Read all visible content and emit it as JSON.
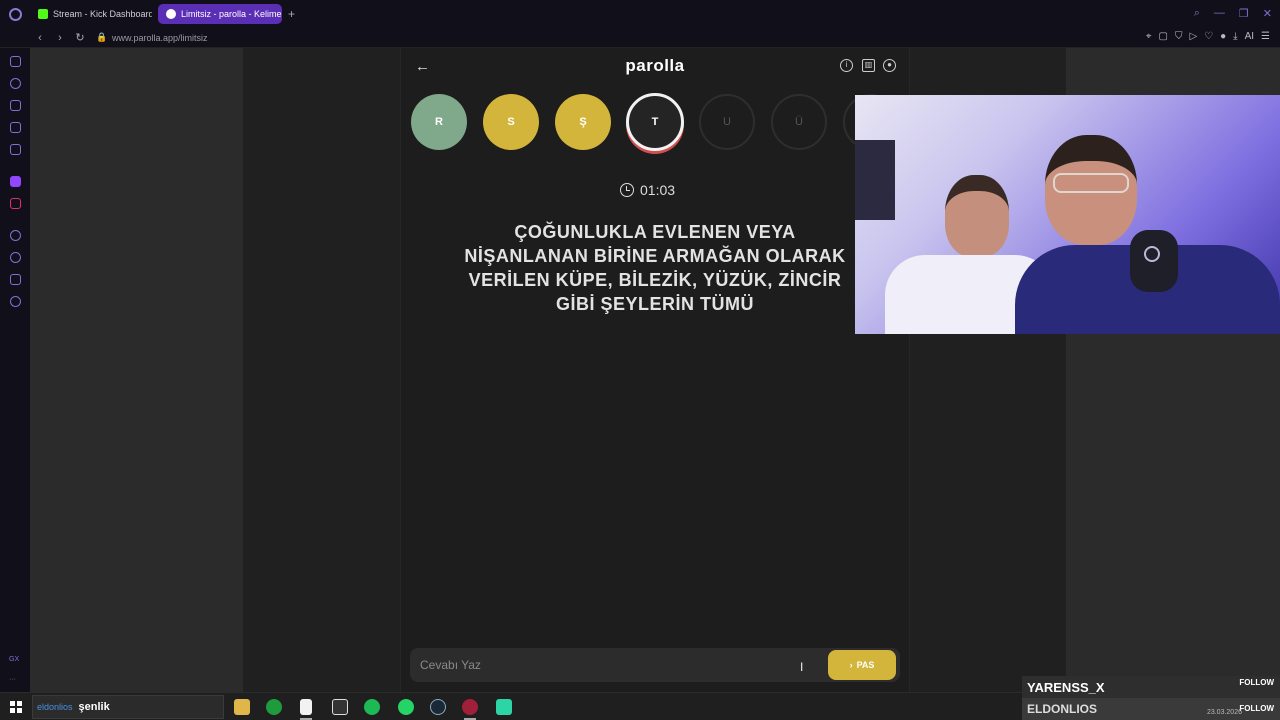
{
  "browser": {
    "tabs": [
      {
        "label": "Stream - Kick Dashboard",
        "active": false
      },
      {
        "label": "Limitsiz - parolla - Kelime",
        "active": true
      }
    ],
    "new_tab": "+",
    "url": "www.parolla.app/limitsiz",
    "ai_label": "AI"
  },
  "app": {
    "brand": "parolla",
    "letters": [
      {
        "char": "R",
        "state": "correct"
      },
      {
        "char": "S",
        "state": "passed"
      },
      {
        "char": "Ş",
        "state": "passed"
      },
      {
        "char": "T",
        "state": "active"
      },
      {
        "char": "U",
        "state": "pending"
      },
      {
        "char": "Ü",
        "state": "pending"
      }
    ],
    "timer": "01:03",
    "question": "ÇOĞUNLUKLA EVLENEN VEYA NİŞANLANAN BİRİNE ARMAĞAN OLARAK VERİLEN KÜPE, BİLEZİK, YÜZÜK, ZİNCİR GİBİ ŞEYLERİN TÜMÜ",
    "answer_placeholder": "Cevabı Yaz",
    "pass_label": "PAS",
    "colors": {
      "correct": "#7fa98a",
      "passed": "#d4b53c",
      "active_ring": "#f2f2f2"
    }
  },
  "sidebar": {
    "bottom_label": "GX",
    "more": "···"
  },
  "overlay": {
    "follower_1": "YARENSS_X",
    "follow_label_1": "FOLLOW",
    "follower_2": "ELDONLIOS",
    "follow_label_2": "FOLLOW"
  },
  "taskbar": {
    "search_user": "eldonlios",
    "search_text": "şenlik",
    "date": "23.03.2026"
  }
}
